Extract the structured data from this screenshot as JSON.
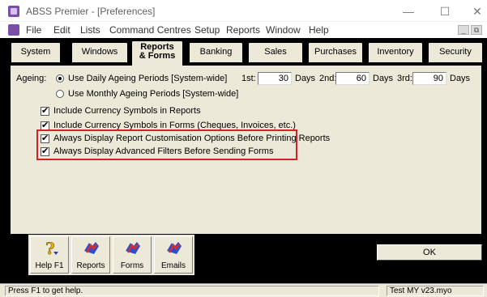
{
  "window": {
    "title": "ABSS Premier - [Preferences]",
    "minimize": "—",
    "maximize": "☐",
    "close": "✕"
  },
  "menu": {
    "items": [
      "File",
      "Edit",
      "Lists",
      "Command Centres",
      "Setup",
      "Reports",
      "Window",
      "Help"
    ],
    "mdi_minimize": "_",
    "mdi_restore": "⧉"
  },
  "tabs": [
    {
      "label": "System"
    },
    {
      "label": "Windows"
    },
    {
      "label_line1": "Reports",
      "label_line2": "& Forms",
      "active": true
    },
    {
      "label": "Banking"
    },
    {
      "label": "Sales"
    },
    {
      "label": "Purchases"
    },
    {
      "label": "Inventory"
    },
    {
      "label": "Security"
    }
  ],
  "ageing": {
    "label": "Ageing:",
    "option_daily": "Use Daily Ageing Periods [System-wide]",
    "option_monthly": "Use Monthly Ageing Periods [System-wide]",
    "selected": "daily",
    "first_label": "1st:",
    "first_value": "30",
    "second_label": "2nd:",
    "second_value": "60",
    "third_label": "3rd:",
    "third_value": "90",
    "days_unit": "Days"
  },
  "options": [
    {
      "label": "Include Currency Symbols in Reports",
      "checked": true
    },
    {
      "label": "Include Currency Symbols in Forms (Cheques, Invoices, etc.)",
      "checked": true
    },
    {
      "label": "Always Display Report Customisation Options Before Printing Reports",
      "checked": true
    },
    {
      "label": "Always Display Advanced Filters Before Sending Forms",
      "checked": true
    }
  ],
  "toolbar": {
    "help": "Help F1",
    "reports": "Reports",
    "forms": "Forms",
    "emails": "Emails"
  },
  "ok_label": "OK",
  "status": {
    "hint": "Press F1 to get help.",
    "file": "Test MY v23.myo"
  },
  "colors": {
    "highlight_box": "#d8202c",
    "panel": "#ece9d8",
    "app_icon": "#7a4fa8"
  }
}
